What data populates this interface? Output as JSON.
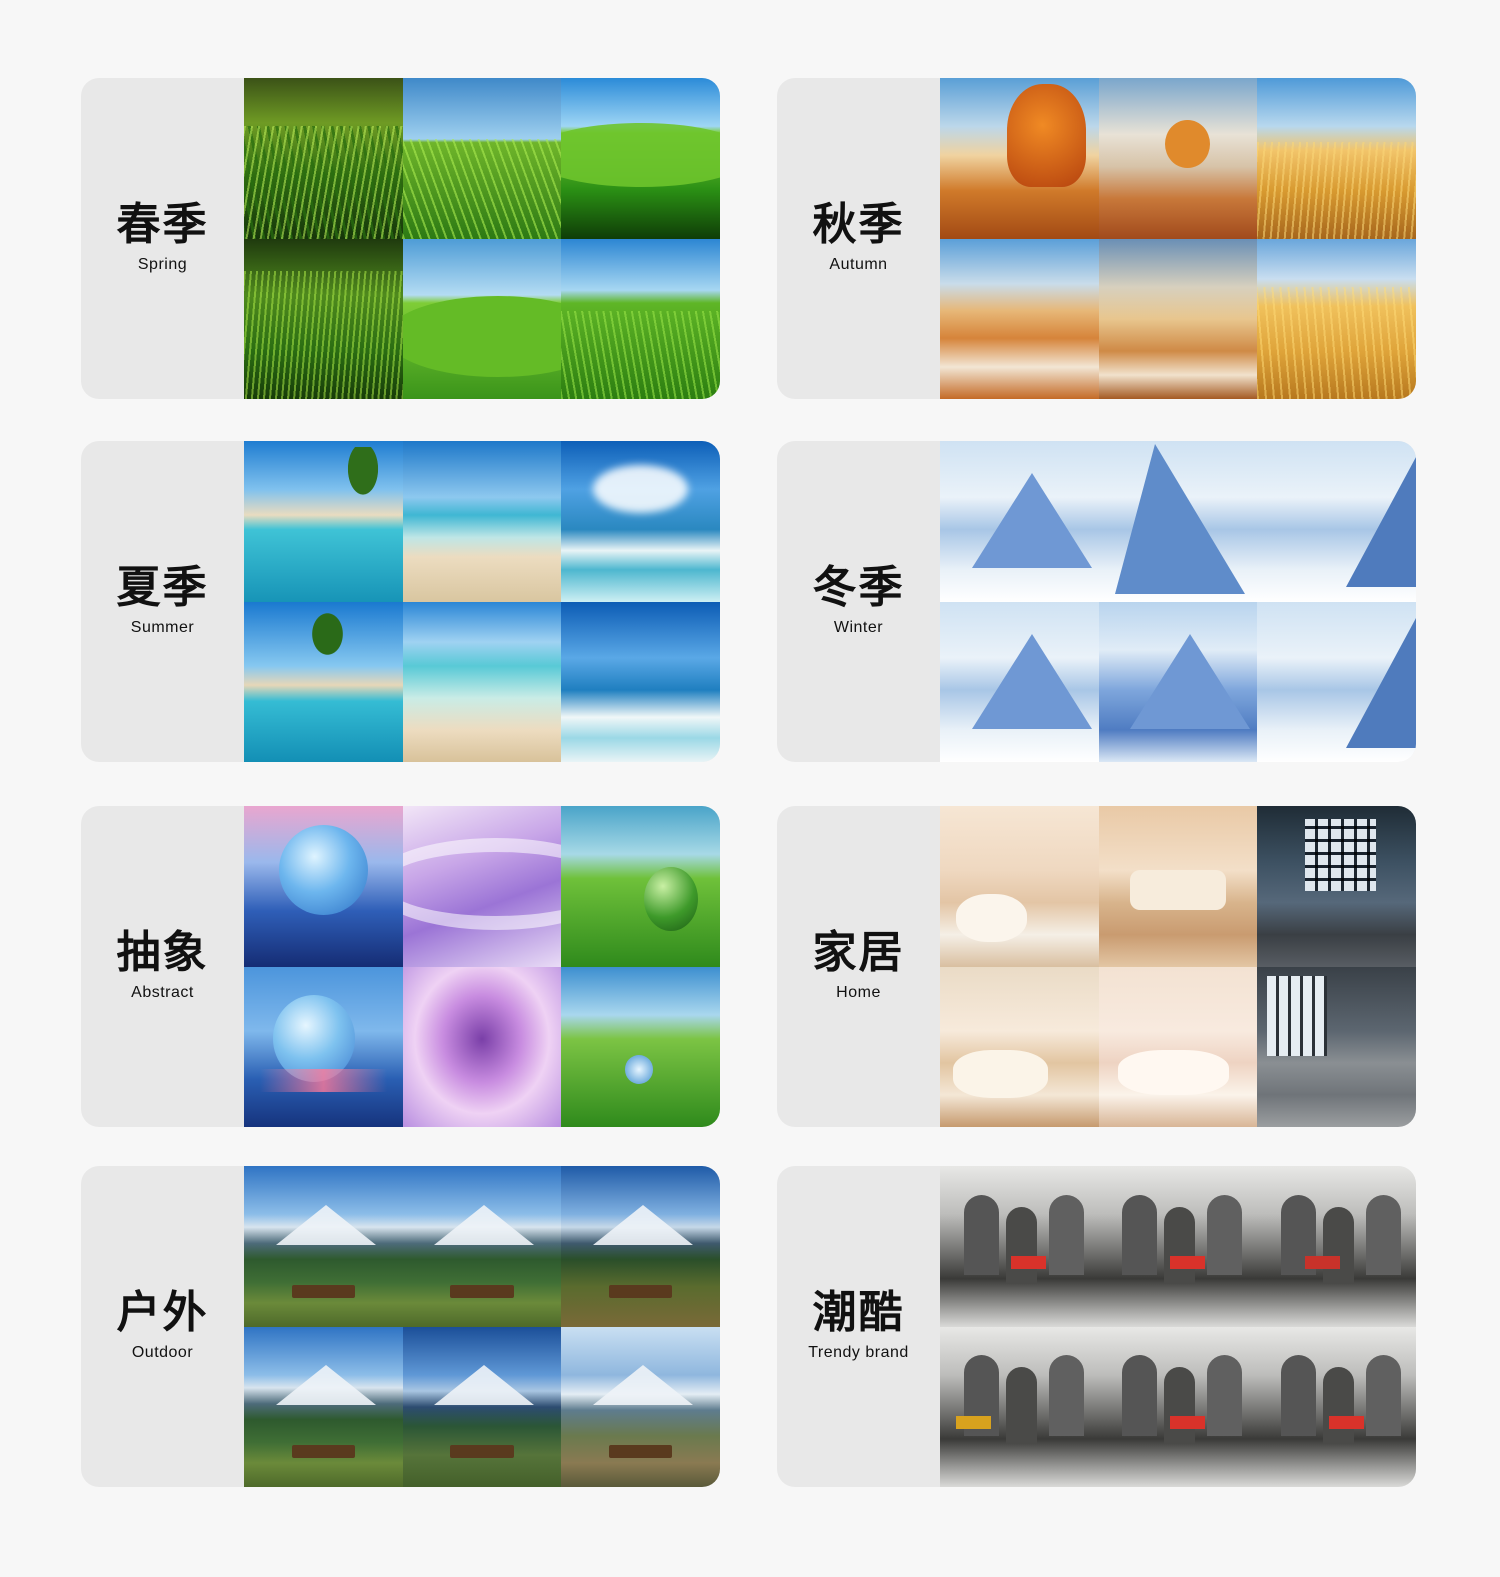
{
  "cards": [
    {
      "id": "spring",
      "zh": "春季",
      "en": "Spring",
      "tile_colors": [
        "#2f6e10",
        "#6fb52a",
        "#2a8e14",
        "#4f8a1d",
        "#7fcd37",
        "#5fb626"
      ]
    },
    {
      "id": "autumn",
      "zh": "秋季",
      "en": "Autumn",
      "tile_colors": [
        "#d07a2a",
        "#c8783a",
        "#d89a30",
        "#d6843a",
        "#cf8a46",
        "#dfa43a"
      ]
    },
    {
      "id": "summer",
      "zh": "夏季",
      "en": "Summer",
      "tile_colors": [
        "#1794b7",
        "#3fb7d3",
        "#2a88c0",
        "#138fb5",
        "#58c9d6",
        "#1f7fc0"
      ]
    },
    {
      "id": "winter",
      "zh": "冬季",
      "en": "Winter",
      "tile_colors": [
        "#a8c6e6",
        "#5f8cca",
        "#4f7bbd",
        "#6f98d4",
        "#7ea6dc",
        "#4f7bbd"
      ]
    },
    {
      "id": "abstract",
      "zh": "抽象",
      "en": "Abstract",
      "tile_colors": [
        "#2f5fb8",
        "#9b74d6",
        "#6fc13a",
        "#2a5fb3",
        "#c88ce0",
        "#7cc444"
      ]
    },
    {
      "id": "home",
      "zh": "家居",
      "en": "Home",
      "tile_colors": [
        "#efd8c0",
        "#d8b48c",
        "#3d5162",
        "#e2c5a1",
        "#eed3c2",
        "#5c6670"
      ]
    },
    {
      "id": "outdoor",
      "zh": "户外",
      "en": "Outdoor",
      "tile_colors": [
        "#2e5a2e",
        "#2e5a2e",
        "#2a4f2a",
        "#2e5a2e",
        "#2b5636",
        "#6a7a4e"
      ]
    },
    {
      "id": "trendy",
      "zh": "潮酷",
      "en": "Trendy brand",
      "tile_colors": [
        "#6d6d6b",
        "#6d6d6b",
        "#6d6d6b",
        "#6d6d6b",
        "#6d6d6b",
        "#6d6d6b"
      ]
    }
  ],
  "colors": {
    "page_bg": "#f7f7f7",
    "card_bg": "#e8e8e8",
    "text": "#111111"
  }
}
